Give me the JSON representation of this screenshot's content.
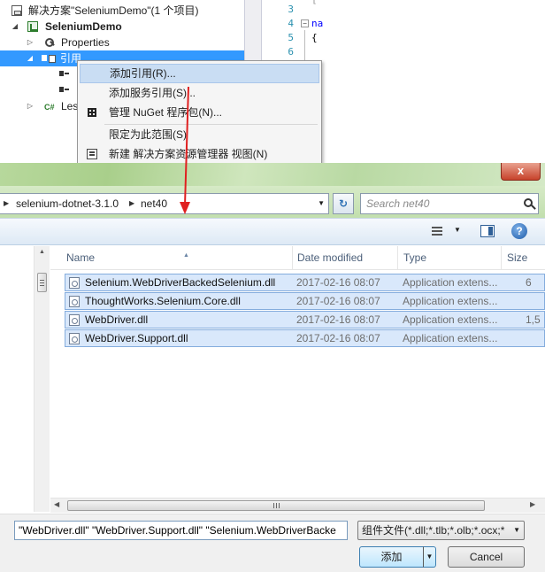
{
  "solution_explorer": {
    "solution_label": "解决方案\"SeleniumDemo\"(1 个项目)",
    "project_label": "SeleniumDemo",
    "properties_label": "Properties",
    "references_label": "引用",
    "leaf_label": "Les"
  },
  "code_editor": {
    "lines": [
      {
        "num": "3",
        "text": ""
      },
      {
        "num": "4",
        "text": "na"
      },
      {
        "num": "5",
        "text": "{"
      },
      {
        "num": "6",
        "text": ""
      }
    ]
  },
  "context_menu": {
    "items": [
      {
        "label": "添加引用(R)...",
        "icon": ""
      },
      {
        "label": "添加服务引用(S)...",
        "icon": ""
      },
      {
        "label": "管理 NuGet 程序包(N)...",
        "icon": "nuget-icon"
      },
      {
        "label": "限定为此范围(S)",
        "icon": ""
      },
      {
        "label": "新建 解决方案资源管理器 视图(N)",
        "icon": "new-view-icon"
      }
    ]
  },
  "file_dialog": {
    "close_glyph": "x",
    "breadcrumb": [
      "selenium-dotnet-3.1.0",
      "net40"
    ],
    "search_placeholder": "Search net40",
    "help_glyph": "?",
    "columns": [
      "Name",
      "Date modified",
      "Type",
      "Size"
    ],
    "files": [
      {
        "name": "Selenium.WebDriverBackedSelenium.dll",
        "date": "2017-02-16 08:07",
        "type": "Application extens...",
        "size": "6"
      },
      {
        "name": "ThoughtWorks.Selenium.Core.dll",
        "date": "2017-02-16 08:07",
        "type": "Application extens...",
        "size": ""
      },
      {
        "name": "WebDriver.dll",
        "date": "2017-02-16 08:07",
        "type": "Application extens...",
        "size": "1,5"
      },
      {
        "name": "WebDriver.Support.dll",
        "date": "2017-02-16 08:07",
        "type": "Application extens...",
        "size": ""
      }
    ],
    "filename_value": "\"WebDriver.dll\" \"WebDriver.Support.dll\" \"Selenium.WebDriverBacke",
    "filetype_value": "组件文件(*.dll;*.tlb;*.olb;*.ocx;*",
    "add_label": "添加",
    "cancel_label": "Cancel"
  },
  "colors": {
    "selection": "#3399ff",
    "menu_hover": "#c9ddf3",
    "arrow": "#e02020",
    "file_selected": "#d9e8fb"
  }
}
